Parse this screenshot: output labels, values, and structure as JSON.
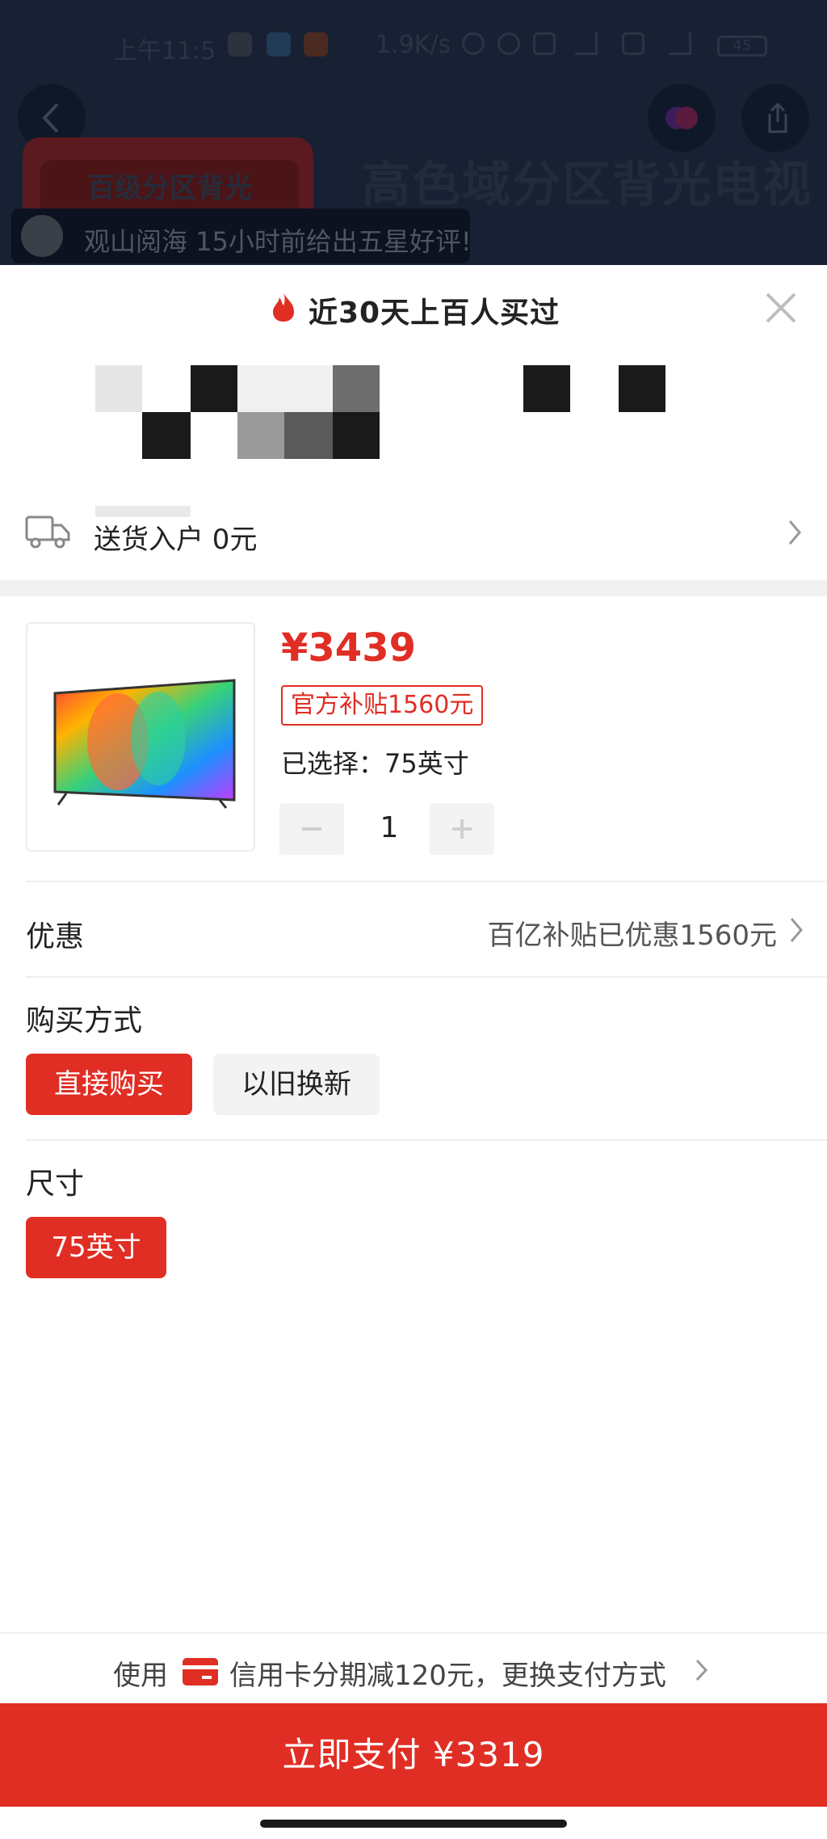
{
  "status_bar": {
    "time": "上午11:5",
    "net_speed": "1.9K/s",
    "battery": "45"
  },
  "background": {
    "promo_card_text": "百级分区背光",
    "headline": "高色域分区背光电视",
    "review_text": "观山阅海 15小时前给出五星好评!"
  },
  "sheet": {
    "title": "近30天上百人买过",
    "delivery": "送货入户 0元",
    "product": {
      "price": "¥3439",
      "subsidy_badge": "官方补贴1560元",
      "selected": "已选择：75英寸",
      "quantity": "1"
    },
    "discount": {
      "label": "优惠",
      "value": "百亿补贴已优惠1560元"
    },
    "purchase_method": {
      "label": "购买方式",
      "options": [
        "直接购买",
        "以旧换新"
      ],
      "selected": "直接购买"
    },
    "size": {
      "label": "尺寸",
      "options": [
        "75英寸"
      ],
      "selected": "75英寸"
    },
    "payment": {
      "prefix": "使用",
      "info": "信用卡分期减120元，更换支付方式",
      "card_icon": "credit-card-icon"
    },
    "pay_button": "立即支付 ¥3319"
  },
  "colors": {
    "accent": "#e02e24",
    "dim_overlay": "#172133"
  }
}
